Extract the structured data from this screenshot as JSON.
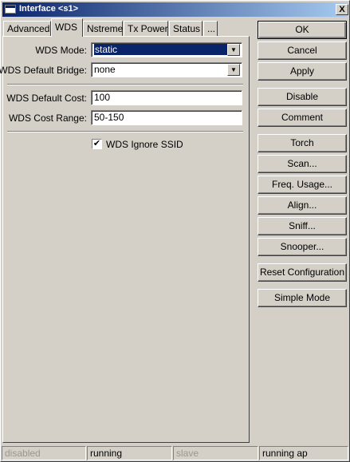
{
  "window": {
    "title": "Interface <s1>",
    "close_glyph": "X"
  },
  "tabs": [
    {
      "label": "Advanced"
    },
    {
      "label": "WDS"
    },
    {
      "label": "Nstreme"
    },
    {
      "label": "Tx Power"
    },
    {
      "label": "Status"
    },
    {
      "label": "..."
    }
  ],
  "active_tab": "WDS",
  "form": {
    "wds_mode": {
      "label": "WDS Mode:",
      "value": "static"
    },
    "wds_default_bridge": {
      "label": "WDS Default Bridge:",
      "value": "none"
    },
    "wds_default_cost": {
      "label": "WDS Default Cost:",
      "value": "100"
    },
    "wds_cost_range": {
      "label": "WDS Cost Range:",
      "value": "50-150"
    },
    "wds_ignore_ssid": {
      "label": "WDS Ignore SSID",
      "checked": true,
      "check_glyph": "✔"
    },
    "dropdown_glyph": "▼"
  },
  "buttons": {
    "ok": "OK",
    "cancel": "Cancel",
    "apply": "Apply",
    "disable": "Disable",
    "comment": "Comment",
    "torch": "Torch",
    "scan": "Scan...",
    "freq_usage": "Freq. Usage...",
    "align": "Align...",
    "sniff": "Sniff...",
    "snooper": "Snooper...",
    "reset_configuration": "Reset Configuration",
    "simple_mode": "Simple Mode"
  },
  "status_bar": [
    {
      "text": "disabled",
      "dimmed": true
    },
    {
      "text": "running",
      "dimmed": false
    },
    {
      "text": "slave",
      "dimmed": true
    },
    {
      "text": "running ap",
      "dimmed": false
    }
  ],
  "colors": {
    "face": "#d4d0c8",
    "title_start": "#0a246a",
    "title_end": "#a6caf0",
    "selection": "#0a246a"
  }
}
